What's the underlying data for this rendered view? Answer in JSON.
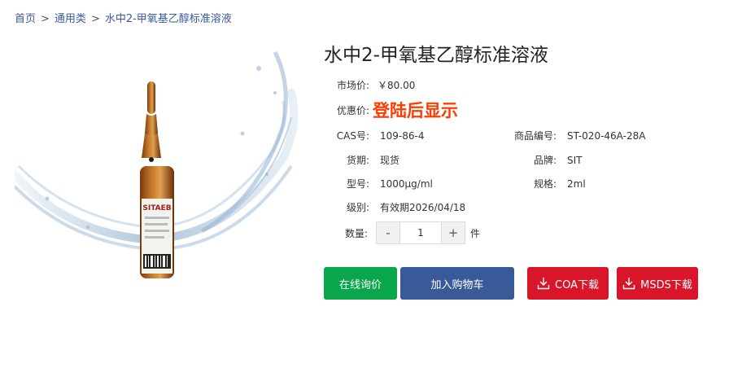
{
  "breadcrumb": {
    "home": "首页",
    "category": "通用类",
    "current": "水中2-甲氧基乙醇标准溶液",
    "separator": ">"
  },
  "product": {
    "title": "水中2-甲氧基乙醇标准溶液",
    "image_label": "SITAEB",
    "market_price_label": "市场价:",
    "market_price": "￥80.00",
    "promo_label": "优惠价:",
    "promo_value": "登陆后显示",
    "cas_label": "CAS号:",
    "cas": "109-86-4",
    "sku_label": "商品编号:",
    "sku": "ST-020-46A-28A",
    "stock_label": "货期:",
    "stock": "现货",
    "brand_label": "品牌:",
    "brand": "SIT",
    "model_label": "型号:",
    "model": "1000μg/ml",
    "spec_label": "规格:",
    "spec": "2ml",
    "grade_label": "级别:",
    "grade": "有效期2026/04/18"
  },
  "quantity": {
    "label": "数量:",
    "minus": "-",
    "value": "1",
    "plus": "+",
    "unit": "件"
  },
  "buttons": {
    "consult": "在线询价",
    "cart": "加入购物车",
    "coa": "COA下载",
    "msds": "MSDS下载"
  },
  "colors": {
    "consult": "#0aa64b",
    "cart": "#3a5998",
    "download": "#d9152a",
    "promo": "#ff3b00",
    "link": "#3d5a99"
  }
}
